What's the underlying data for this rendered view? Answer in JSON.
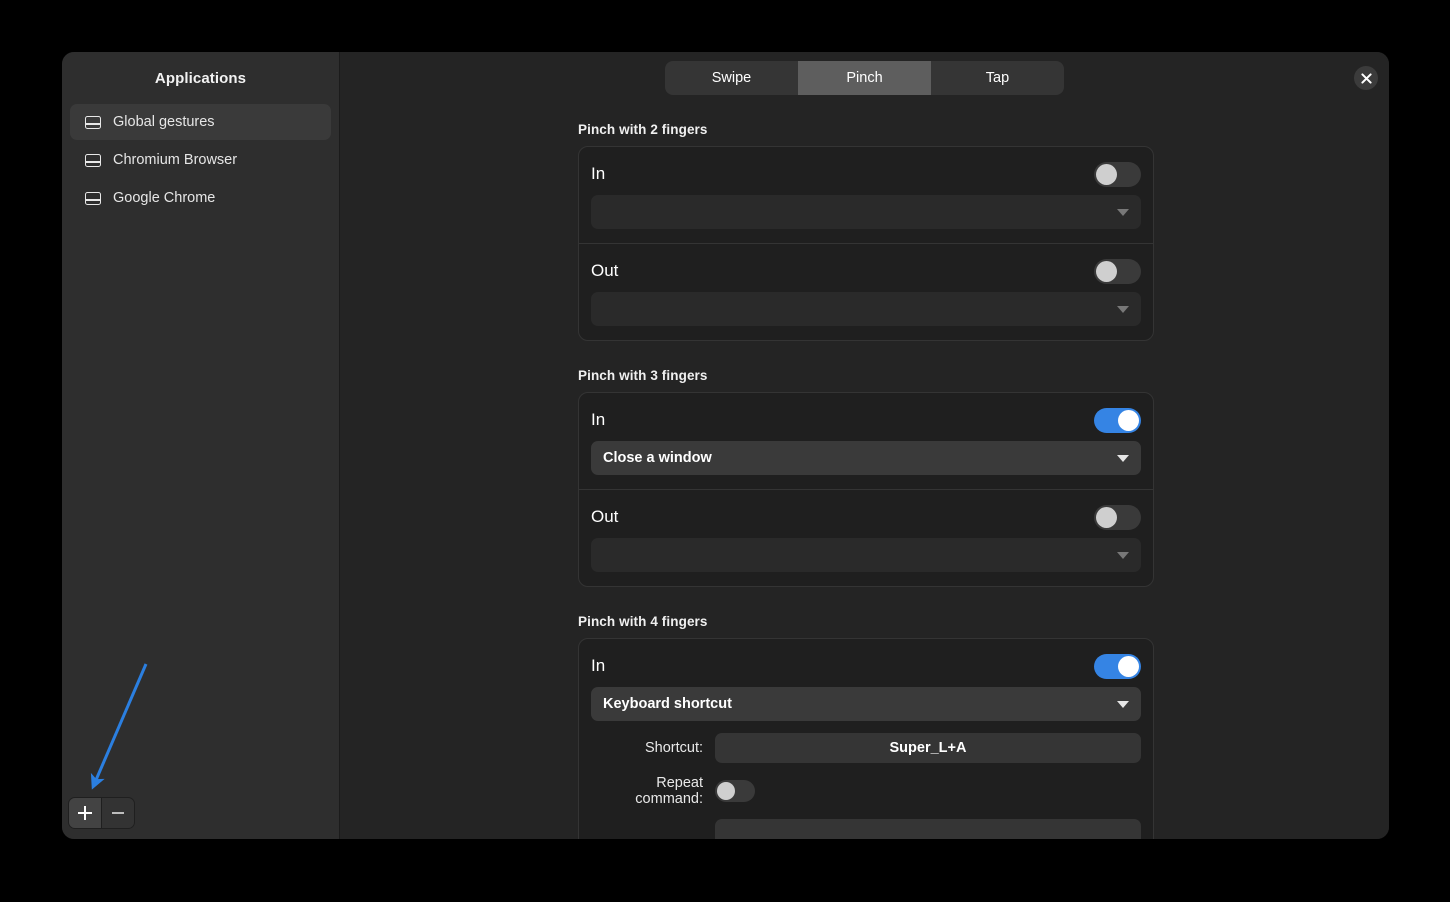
{
  "sidebar": {
    "header": "Applications",
    "items": [
      {
        "label": "Global gestures",
        "icon": "touchpad-icon",
        "selected": true
      },
      {
        "label": "Chromium Browser",
        "icon": "touchpad-icon",
        "selected": false
      },
      {
        "label": "Google Chrome",
        "icon": "touchpad-icon",
        "selected": false
      }
    ],
    "footer": {
      "add_label": "+",
      "remove_label": "−"
    }
  },
  "topbar": {
    "tabs": [
      {
        "label": "Swipe",
        "active": false
      },
      {
        "label": "Pinch",
        "active": true
      },
      {
        "label": "Tap",
        "active": false
      }
    ],
    "close_label": "×"
  },
  "groups": [
    {
      "title": "Pinch with 2 fingers",
      "rows": [
        {
          "label": "In",
          "enabled": false,
          "action": ""
        },
        {
          "label": "Out",
          "enabled": false,
          "action": ""
        }
      ]
    },
    {
      "title": "Pinch with 3 fingers",
      "rows": [
        {
          "label": "In",
          "enabled": true,
          "action": "Close a window"
        },
        {
          "label": "Out",
          "enabled": false,
          "action": ""
        }
      ]
    },
    {
      "title": "Pinch with 4 fingers",
      "rows": [
        {
          "label": "In",
          "enabled": true,
          "action": "Keyboard shortcut",
          "shortcut_label": "Shortcut:",
          "shortcut_value": "Super_L+A",
          "repeat_label": "Repeat command:",
          "repeat_enabled": false
        }
      ]
    }
  ],
  "colors": {
    "accent": "#3584e4",
    "annotation": "#2b7fe0",
    "window_bg": "#242424",
    "sidebar_bg": "#2e2e2e",
    "card_bg": "#1f1f1f"
  }
}
